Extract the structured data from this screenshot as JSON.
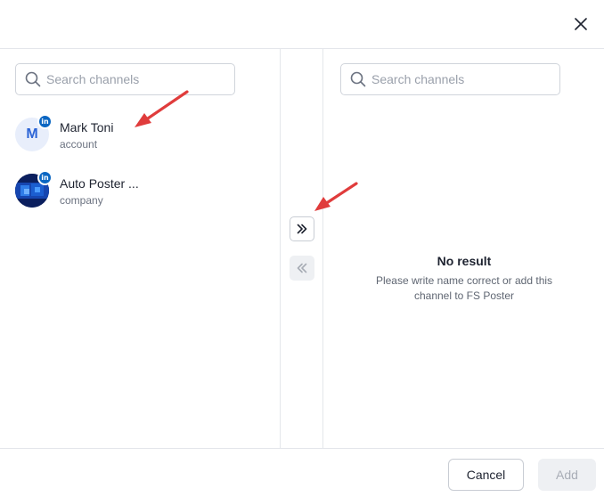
{
  "left_panel": {
    "search": {
      "placeholder": "Search channels",
      "value": ""
    },
    "channels": [
      {
        "name": "Mark Toni",
        "type": "account",
        "avatar_letter": "M",
        "network": "linkedin",
        "badge": "in"
      },
      {
        "name": "Auto Poster ...",
        "type": "company",
        "avatar_letter": "",
        "network": "linkedin",
        "badge": "in"
      }
    ]
  },
  "right_panel": {
    "search": {
      "placeholder": "Search channels",
      "value": ""
    },
    "empty_title": "No result",
    "empty_text": "Please write name correct or add this channel to FS Poster"
  },
  "footer": {
    "cancel_label": "Cancel",
    "add_label": "Add"
  },
  "colors": {
    "linkedin": "#0a66c2",
    "annotation_arrow": "#e03c3c",
    "avatar_letter": "#2c64d6"
  },
  "icons": {
    "close": "close-icon",
    "search": "search-icon",
    "move_right": "double-chevron-right-icon",
    "move_left": "double-chevron-left-icon"
  }
}
